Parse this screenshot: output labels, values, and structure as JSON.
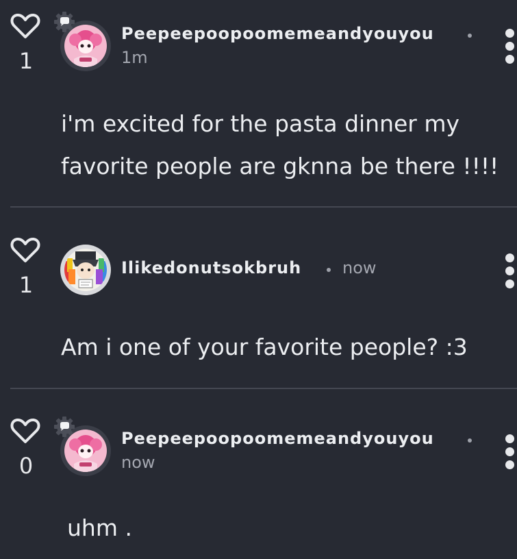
{
  "comments": [
    {
      "likes": "1",
      "username": "Peepeepoopoomemeandyouyou",
      "time": "1m",
      "text_lines": [
        "i'm excited for the pasta dinner my",
        "favorite people are gknna be there !!!!"
      ]
    },
    {
      "likes": "1",
      "username": "Ilikedonutsokbruh",
      "time": "now",
      "text_lines": [
        "Am i one of your favorite people? :3"
      ]
    },
    {
      "likes": "0",
      "username": "Peepeepoopoomemeandyouyou",
      "time": "now",
      "text_lines": [
        "uhm ."
      ]
    }
  ],
  "icons": {
    "like": "heart-outline-icon",
    "more": "vertical-ellipsis-icon",
    "badge": "gear-chat-badge-icon"
  },
  "colors": {
    "background": "#272a33",
    "text": "#eceef1",
    "muted": "#a4a7b0",
    "divider": "#454852"
  }
}
